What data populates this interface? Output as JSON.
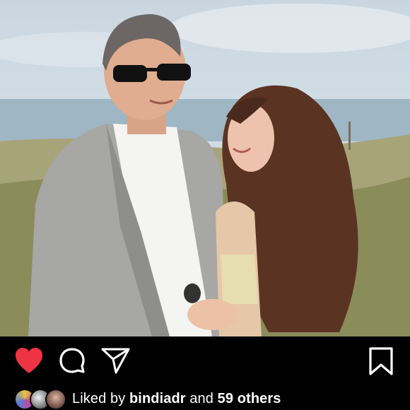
{
  "post": {
    "image_alt": "Couple photo by the sea",
    "actions": {
      "heart": "heart-filled-icon",
      "comment": "comment-icon",
      "share": "share-icon",
      "bookmark": "bookmark-icon",
      "heart_color": "#ee3344"
    },
    "likes": {
      "prefix": "Liked by",
      "user": "bindiadr",
      "and": "and",
      "others": "59 others"
    }
  }
}
